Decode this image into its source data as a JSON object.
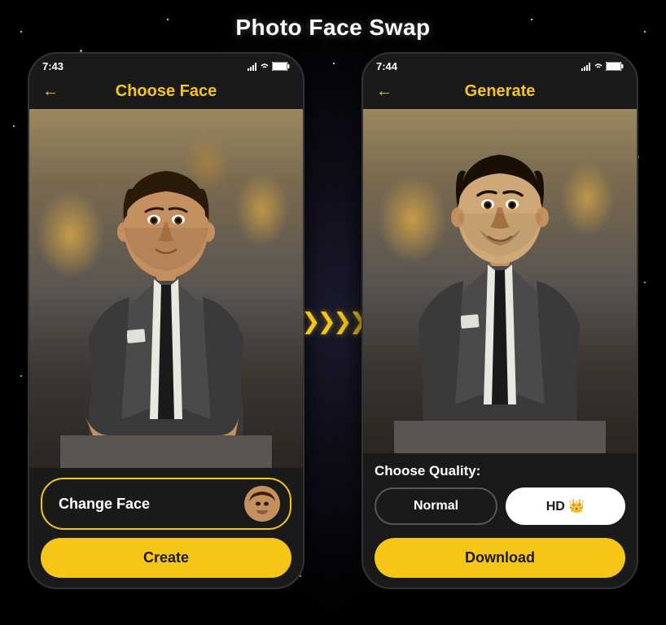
{
  "page": {
    "title": "Photo Face Swap",
    "background": "#000"
  },
  "left_phone": {
    "status_time": "7:43",
    "header_title": "Choose Face",
    "back_label": "←",
    "change_face_label": "Change Face",
    "create_btn_label": "Create"
  },
  "right_phone": {
    "status_time": "7:44",
    "header_title": "Generate",
    "back_label": "←",
    "quality_label": "Choose Quality:",
    "normal_btn_label": "Normal",
    "hd_btn_label": "HD 👑",
    "download_btn_label": "Download"
  },
  "arrow": "❯❯❯❯"
}
